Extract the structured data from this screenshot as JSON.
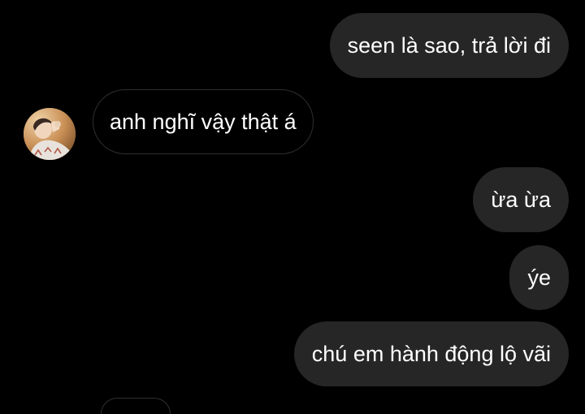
{
  "conversation": {
    "messages": [
      {
        "sender": "me",
        "text": "seen là sao, trả lời đi"
      },
      {
        "sender": "them",
        "text": "anh nghĩ vậy thật á"
      },
      {
        "sender": "me",
        "text": "ừa ừa"
      },
      {
        "sender": "me",
        "text": "ýe"
      },
      {
        "sender": "me",
        "text": "chú em hành động lộ vãi"
      }
    ]
  },
  "colors": {
    "background": "#000000",
    "sent_bubble": "#262626",
    "received_border": "#2f2f2f",
    "text": "#ffffff"
  },
  "icons": {
    "contact_avatar": "profile-photo"
  }
}
